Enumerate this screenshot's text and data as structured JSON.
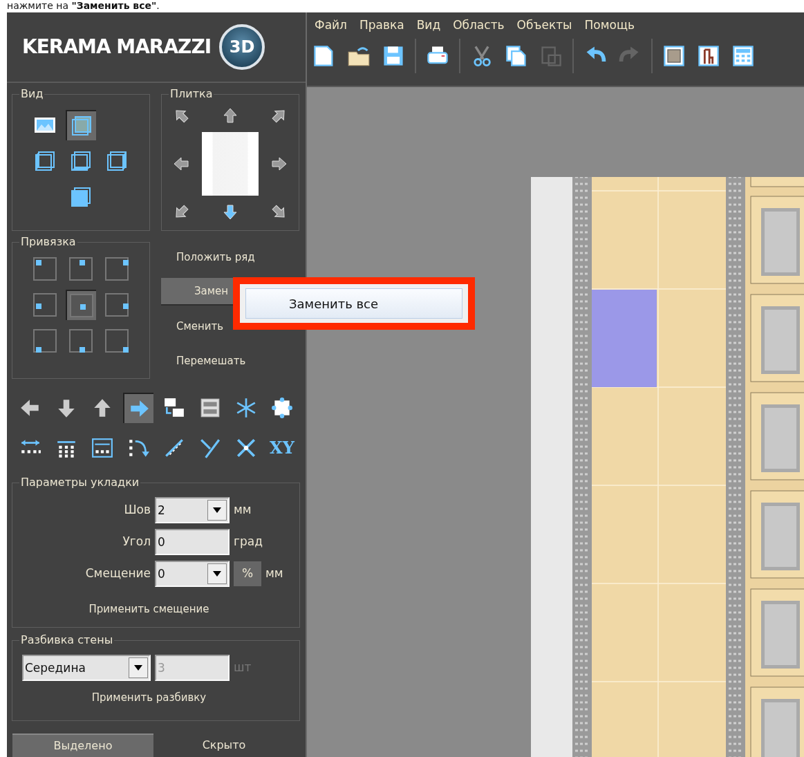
{
  "caption": "нажмите на **\"Заменить все\"**.",
  "logo": {
    "text": "KERAMA MARAZZI",
    "badge": "3D"
  },
  "menu": [
    "Файл",
    "Правка",
    "Вид",
    "Область",
    "Объекты",
    "Помощь"
  ],
  "toolbar": [
    [
      {
        "kind": "new",
        "disabled": false
      },
      {
        "kind": "open",
        "disabled": false
      },
      {
        "kind": "save",
        "disabled": false
      }
    ],
    [
      {
        "kind": "print",
        "disabled": false
      }
    ],
    [
      {
        "kind": "cut",
        "disabled": false
      },
      {
        "kind": "copy",
        "disabled": false
      },
      {
        "kind": "paste",
        "disabled": true
      }
    ],
    [
      {
        "kind": "undo",
        "disabled": false
      },
      {
        "kind": "redo",
        "disabled": true
      }
    ],
    [
      {
        "kind": "tile",
        "disabled": false
      },
      {
        "kind": "chair",
        "disabled": false
      },
      {
        "kind": "calc",
        "disabled": false
      }
    ]
  ],
  "view_group": {
    "title": "Вид",
    "buttons": [
      {
        "kind": "picture",
        "selected": false
      },
      {
        "kind": "cube-back",
        "selected": true
      },
      {
        "kind": "cube-left",
        "selected": false
      },
      {
        "kind": "cube-bottom",
        "selected": false
      },
      {
        "kind": "cube-right",
        "selected": false
      },
      {
        "kind": "cube-front",
        "selected": false
      }
    ]
  },
  "tile_group": {
    "title": "Плитка",
    "arrows": [
      {
        "selected": false
      },
      {
        "selected": false
      },
      {
        "selected": false
      },
      {
        "selected": false
      },
      {
        "selected": false
      },
      {
        "selected": false
      },
      {
        "selected": true
      },
      {
        "selected": false
      }
    ]
  },
  "snap_group": {
    "title": "Привязка",
    "cells": [
      {
        "selected": false
      },
      {
        "selected": false
      },
      {
        "selected": false
      },
      {
        "selected": false
      },
      {
        "selected": true
      },
      {
        "selected": false
      },
      {
        "selected": false
      },
      {
        "selected": false
      },
      {
        "selected": false
      }
    ]
  },
  "actions": [
    {
      "label": "Положить ряд",
      "selected": false
    },
    {
      "label": "Замен",
      "selected": true
    },
    {
      "label": "Сменить",
      "selected": false
    },
    {
      "label": "Перемешать",
      "selected": false
    }
  ],
  "popup": {
    "item": "Заменить все"
  },
  "tools": [
    {
      "kind": "arrow-left",
      "selected": false
    },
    {
      "kind": "arrow-down",
      "selected": false
    },
    {
      "kind": "arrow-up",
      "selected": false
    },
    {
      "kind": "arrow-right",
      "selected": true
    },
    {
      "kind": "swap",
      "selected": false
    },
    {
      "kind": "rows",
      "selected": false
    },
    {
      "kind": "snowflake",
      "selected": false
    },
    {
      "kind": "frame",
      "selected": false
    },
    {
      "kind": "spread-row",
      "selected": false
    },
    {
      "kind": "spread-grid",
      "selected": false
    },
    {
      "kind": "spread-box",
      "selected": false
    },
    {
      "kind": "rotate",
      "selected": false
    },
    {
      "kind": "diagonal",
      "selected": false
    },
    {
      "kind": "fork",
      "selected": false
    },
    {
      "kind": "cross",
      "selected": false
    },
    {
      "kind": "text",
      "label": "XY",
      "selected": false
    }
  ],
  "layout_params": {
    "title": "Параметры укладки",
    "fields": [
      {
        "label": "Шов",
        "value": "2",
        "kind": "dropdown",
        "unit": "мм"
      },
      {
        "label": "Угол",
        "value": "0",
        "kind": "text",
        "unit": "град"
      },
      {
        "label": "Смещение",
        "value": "0",
        "kind": "dropdown",
        "toggle": "%",
        "unit": "мм"
      }
    ],
    "apply": "Применить смещение"
  },
  "wall_split": {
    "title": "Разбивка стены",
    "mode": "Середина",
    "count": "3",
    "count_disabled": true,
    "unit": "шт",
    "apply": "Применить разбивку"
  },
  "bottom_tabs": [
    {
      "label": "Выделено",
      "selected": true
    },
    {
      "label": "Скрыто",
      "selected": false
    }
  ]
}
